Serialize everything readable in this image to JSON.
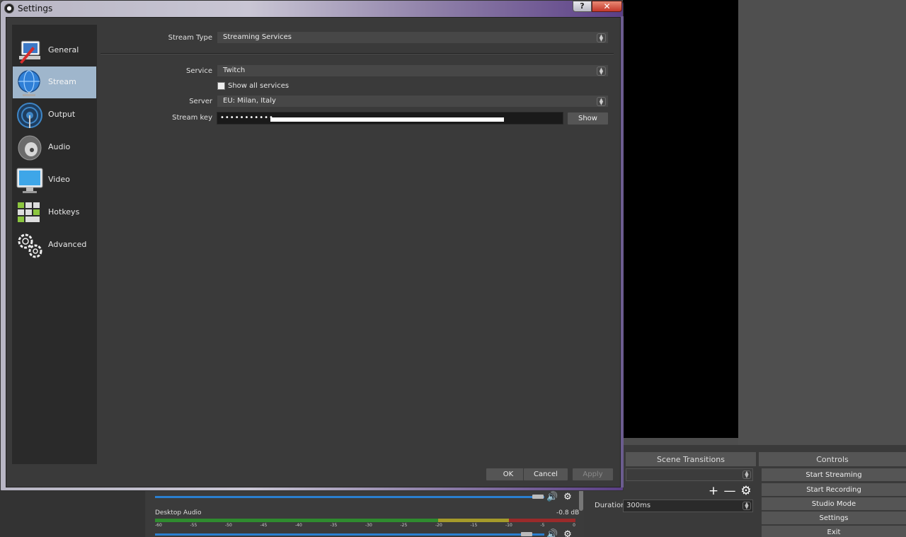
{
  "window": {
    "title": "Settings",
    "help_label": "?",
    "close_label": "✕"
  },
  "categories": [
    {
      "label": "General",
      "icon": "general-icon"
    },
    {
      "label": "Stream",
      "icon": "globe-icon",
      "selected": true
    },
    {
      "label": "Output",
      "icon": "output-icon"
    },
    {
      "label": "Audio",
      "icon": "speaker-icon"
    },
    {
      "label": "Video",
      "icon": "monitor-icon"
    },
    {
      "label": "Hotkeys",
      "icon": "keyboard-icon"
    },
    {
      "label": "Advanced",
      "icon": "gears-icon"
    }
  ],
  "stream": {
    "stream_type_label": "Stream Type",
    "stream_type_value": "Streaming Services",
    "service_label": "Service",
    "service_value": "Twitch",
    "show_all_label": "Show all services",
    "show_all_checked": false,
    "server_label": "Server",
    "server_value": "EU: Milan, Italy",
    "stream_key_label": "Stream key",
    "stream_key_masked": "•••••••••••",
    "show_button": "Show"
  },
  "dialog_buttons": {
    "ok": "OK",
    "cancel": "Cancel",
    "apply": "Apply"
  },
  "main_window": {
    "scene_transitions_title": "Scene Transitions",
    "controls_title": "Controls",
    "duration_label": "Duration",
    "duration_value": "300ms",
    "controls": [
      "Start Streaming",
      "Start Recording",
      "Studio Mode",
      "Settings",
      "Exit"
    ],
    "mixer": {
      "desktop_audio_label": "Desktop Audio",
      "desktop_audio_db": "-0.8 dB",
      "meter_ticks": [
        "-60",
        "-55",
        "-50",
        "-45",
        "-40",
        "-35",
        "-30",
        "-25",
        "-20",
        "-15",
        "-10",
        "-5",
        "0"
      ]
    }
  },
  "colors": {
    "selected_category": "#9fb6cc",
    "volume_track": "#2a7fd0",
    "close_red": "#c4372a"
  }
}
